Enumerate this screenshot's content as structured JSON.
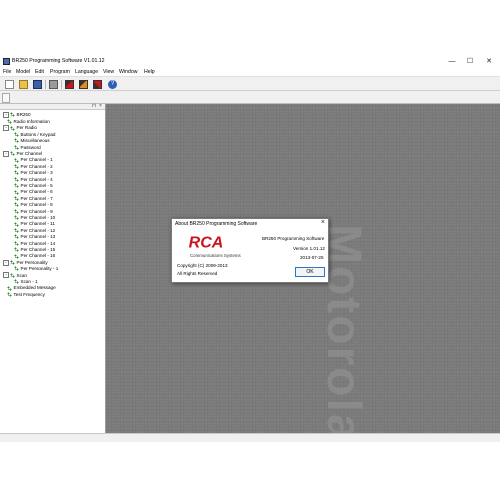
{
  "window": {
    "title": "BR250 Programming Software V1.01.12",
    "controls": {
      "minimize": "—",
      "maximize": "☐",
      "close": "✕"
    }
  },
  "menu": [
    "File",
    "Model",
    "Edit",
    "Program",
    "Language",
    "View",
    "Window",
    "Help"
  ],
  "toolbar": {
    "icons": [
      "new-file-icon",
      "open-folder-icon",
      "save-icon",
      "print-icon",
      "read-radio-icon",
      "write-radio-icon",
      "delete-icon",
      "help-icon"
    ]
  },
  "tree": {
    "root": "BR250",
    "items": [
      {
        "label": "Radio Information",
        "level": 1,
        "expandable": false
      },
      {
        "label": "Per Radio",
        "level": 1,
        "expandable": true
      },
      {
        "label": "Buttons / Keypad",
        "level": 2,
        "expandable": false
      },
      {
        "label": "Miscellaneous",
        "level": 2,
        "expandable": false
      },
      {
        "label": "Password",
        "level": 2,
        "expandable": false
      },
      {
        "label": "Per Channel",
        "level": 1,
        "expandable": true
      },
      {
        "label": "Per Channel - 1",
        "level": 2,
        "expandable": false
      },
      {
        "label": "Per Channel - 2",
        "level": 2,
        "expandable": false
      },
      {
        "label": "Per Channel - 3",
        "level": 2,
        "expandable": false
      },
      {
        "label": "Per Channel - 4",
        "level": 2,
        "expandable": false
      },
      {
        "label": "Per Channel - 5",
        "level": 2,
        "expandable": false
      },
      {
        "label": "Per Channel - 6",
        "level": 2,
        "expandable": false
      },
      {
        "label": "Per Channel - 7",
        "level": 2,
        "expandable": false
      },
      {
        "label": "Per Channel - 8",
        "level": 2,
        "expandable": false
      },
      {
        "label": "Per Channel - 9",
        "level": 2,
        "expandable": false
      },
      {
        "label": "Per Channel - 10",
        "level": 2,
        "expandable": false
      },
      {
        "label": "Per Channel - 11",
        "level": 2,
        "expandable": false
      },
      {
        "label": "Per Channel - 12",
        "level": 2,
        "expandable": false
      },
      {
        "label": "Per Channel - 13",
        "level": 2,
        "expandable": false
      },
      {
        "label": "Per Channel - 14",
        "level": 2,
        "expandable": false
      },
      {
        "label": "Per Channel - 15",
        "level": 2,
        "expandable": false
      },
      {
        "label": "Per Channel - 16",
        "level": 2,
        "expandable": false
      },
      {
        "label": "Per Personality",
        "level": 1,
        "expandable": true
      },
      {
        "label": "Per Personality - 1",
        "level": 2,
        "expandable": false
      },
      {
        "label": "Scan",
        "level": 1,
        "expandable": true
      },
      {
        "label": "Scan - 1",
        "level": 2,
        "expandable": false
      },
      {
        "label": "Embedded Message",
        "level": 1,
        "expandable": false
      },
      {
        "label": "Test Frequency",
        "level": 1,
        "expandable": false
      }
    ]
  },
  "background_watermark": "Motorola",
  "about_dialog": {
    "title": "About BR250 Programming Software",
    "logo_text": "RCA",
    "logo_subtitle": "Communications Systems",
    "product": "BR250 Programming Software",
    "version": "Version 1.01.12",
    "date": "2013-07-25",
    "copyright": "Copyright (C) 2009-2013",
    "rights": "All Rights Reserved",
    "ok_label": "OK"
  },
  "colors": {
    "rca_red": "#c8161d",
    "tree_green": "#2d8a2d",
    "ok_border": "#2f72c9"
  }
}
